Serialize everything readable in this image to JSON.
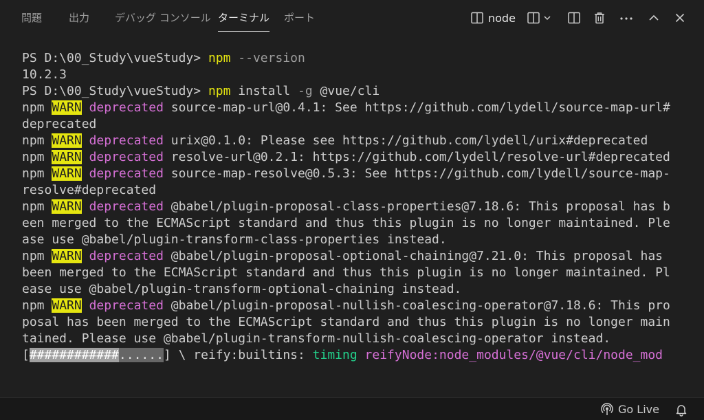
{
  "panel": {
    "tabs": [
      {
        "label": "問題",
        "active": false
      },
      {
        "label": "出力",
        "active": false
      },
      {
        "label": "デバッグ コンソール",
        "active": false
      },
      {
        "label": "ターミナル",
        "active": true
      },
      {
        "label": "ポート",
        "active": false
      }
    ],
    "toolbar": {
      "terminal_name": "node",
      "icons": [
        "terminal-icon",
        "split-terminal-icon",
        "chevron-down-icon",
        "split-editor-icon",
        "trash-icon",
        "more-icon",
        "chevron-up-icon",
        "close-icon"
      ]
    }
  },
  "terminal": {
    "lines": [
      [
        {
          "t": "PS D:\\00_Study\\vueStudy> "
        },
        {
          "t": "npm",
          "c": "yellow"
        },
        {
          "t": " --version",
          "c": "gray"
        }
      ],
      [
        {
          "t": "10.2.3"
        }
      ],
      [
        {
          "t": "PS D:\\00_Study\\vueStudy> "
        },
        {
          "t": "npm",
          "c": "yellow"
        },
        {
          "t": " install "
        },
        {
          "t": "-g",
          "c": "gray"
        },
        {
          "t": " @vue/cli"
        }
      ],
      [
        {
          "t": "npm "
        },
        {
          "t": "WARN",
          "c": "warn"
        },
        {
          "t": " "
        },
        {
          "t": "deprecated",
          "c": "magenta"
        },
        {
          "t": " source-map-url@0.4.1: See https://github.com/lydell/source-map-url#"
        }
      ],
      [
        {
          "t": "deprecated"
        }
      ],
      [
        {
          "t": "npm "
        },
        {
          "t": "WARN",
          "c": "warn"
        },
        {
          "t": " "
        },
        {
          "t": "deprecated",
          "c": "magenta"
        },
        {
          "t": " urix@0.1.0: Please see https://github.com/lydell/urix#deprecated"
        }
      ],
      [
        {
          "t": "npm "
        },
        {
          "t": "WARN",
          "c": "warn"
        },
        {
          "t": " "
        },
        {
          "t": "deprecated",
          "c": "magenta"
        },
        {
          "t": " resolve-url@0.2.1: https://github.com/lydell/resolve-url#deprecated"
        }
      ],
      [
        {
          "t": "npm "
        },
        {
          "t": "WARN",
          "c": "warn"
        },
        {
          "t": " "
        },
        {
          "t": "deprecated",
          "c": "magenta"
        },
        {
          "t": " source-map-resolve@0.5.3: See https://github.com/lydell/source-map-"
        }
      ],
      [
        {
          "t": "resolve#deprecated"
        }
      ],
      [
        {
          "t": "npm "
        },
        {
          "t": "WARN",
          "c": "warn"
        },
        {
          "t": " "
        },
        {
          "t": "deprecated",
          "c": "magenta"
        },
        {
          "t": " @babel/plugin-proposal-class-properties@7.18.6: This proposal has b"
        }
      ],
      [
        {
          "t": "een merged to the ECMAScript standard and thus this plugin is no longer maintained. Ple"
        }
      ],
      [
        {
          "t": "ase use @babel/plugin-transform-class-properties instead."
        }
      ],
      [
        {
          "t": "npm "
        },
        {
          "t": "WARN",
          "c": "warn"
        },
        {
          "t": " "
        },
        {
          "t": "deprecated",
          "c": "magenta"
        },
        {
          "t": " @babel/plugin-proposal-optional-chaining@7.21.0: This proposal has"
        }
      ],
      [
        {
          "t": "been merged to the ECMAScript standard and thus this plugin is no longer maintained. Pl"
        }
      ],
      [
        {
          "t": "ease use @babel/plugin-transform-optional-chaining instead."
        }
      ],
      [
        {
          "t": "npm "
        },
        {
          "t": "WARN",
          "c": "warn"
        },
        {
          "t": " "
        },
        {
          "t": "deprecated",
          "c": "magenta"
        },
        {
          "t": " @babel/plugin-proposal-nullish-coalescing-operator@7.18.6: This pro"
        }
      ],
      [
        {
          "t": "posal has been merged to the ECMAScript standard and thus this plugin is no longer main"
        }
      ],
      [
        {
          "t": "tained. Please use @babel/plugin-transform-nullish-coalescing-operator instead."
        }
      ],
      [
        {
          "t": "["
        },
        {
          "t": "############",
          "c": "prog-fill"
        },
        {
          "t": "......",
          "c": "prog-empty"
        },
        {
          "t": "] \\ reify:builtins: "
        },
        {
          "t": "timing",
          "c": "green"
        },
        {
          "t": " "
        },
        {
          "t": "reifyNode:node_modules/@vue/cli/node_mod",
          "c": "magenta"
        }
      ]
    ]
  },
  "statusbar": {
    "go_live_label": "Go Live"
  }
}
